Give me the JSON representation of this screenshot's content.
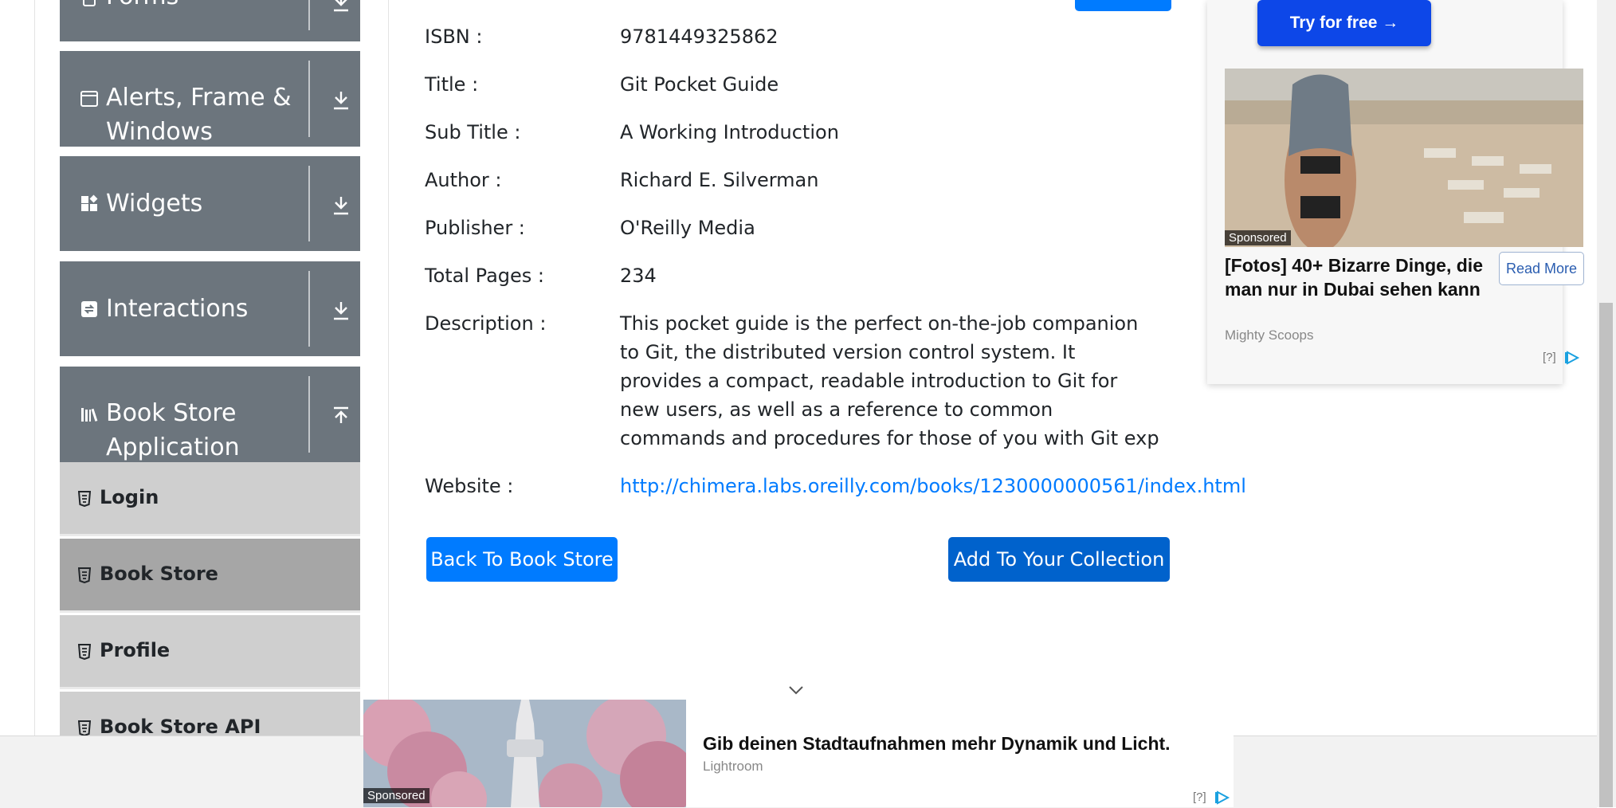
{
  "sidebar": {
    "groups": [
      {
        "label": "Forms",
        "name": "forms"
      },
      {
        "label": "Alerts, Frame & Windows",
        "name": "alerts-frame-windows"
      },
      {
        "label": "Widgets",
        "name": "widgets"
      },
      {
        "label": "Interactions",
        "name": "interactions"
      },
      {
        "label": "Book Store Application",
        "name": "book-store-application"
      }
    ],
    "book_store_items": [
      {
        "label": "Login"
      },
      {
        "label": "Book Store"
      },
      {
        "label": "Profile"
      },
      {
        "label": "Book Store API"
      }
    ]
  },
  "book": {
    "isbn_label": "ISBN :",
    "isbn": "9781449325862",
    "title_label": "Title :",
    "title": "Git Pocket Guide",
    "subtitle_label": "Sub Title :",
    "subtitle": "A Working Introduction",
    "author_label": "Author :",
    "author": "Richard E. Silverman",
    "publisher_label": "Publisher :",
    "publisher": "O'Reilly Media",
    "pages_label": "Total Pages :",
    "pages": "234",
    "description_label": "Description :",
    "description": "This pocket guide is the perfect on-the-job companion to Git, the distributed version control system. It provides a compact, readable introduction to Git for new users, as well as a reference to common commands and procedures for those of you with Git exp",
    "website_label": "Website :",
    "website": "http://chimera.labs.oreilly.com/books/1230000000561/index.html"
  },
  "actions": {
    "back_label": "Back To Book Store",
    "add_label": "Add To Your Collection"
  },
  "ad_right": {
    "cta": "Try for free →",
    "sponsored": "Sponsored",
    "headline": "[Fotos] 40+ Bizarre Dinge, die man nur in Dubai sehen kann",
    "source": "Mighty Scoops",
    "read_more": "Read More",
    "help": "[?]"
  },
  "ad_bottom": {
    "sponsored": "Sponsored",
    "headline": "Gib deinen Stadtaufnahmen mehr Dynamik und Licht.",
    "source": "Lightroom",
    "help": "[?]"
  },
  "colors": {
    "sidebar_group": "#6c757d",
    "sub_item": "#cfcfcf",
    "sub_item_active": "#a6a6a6",
    "primary": "#007bff",
    "link": "#007bff"
  }
}
